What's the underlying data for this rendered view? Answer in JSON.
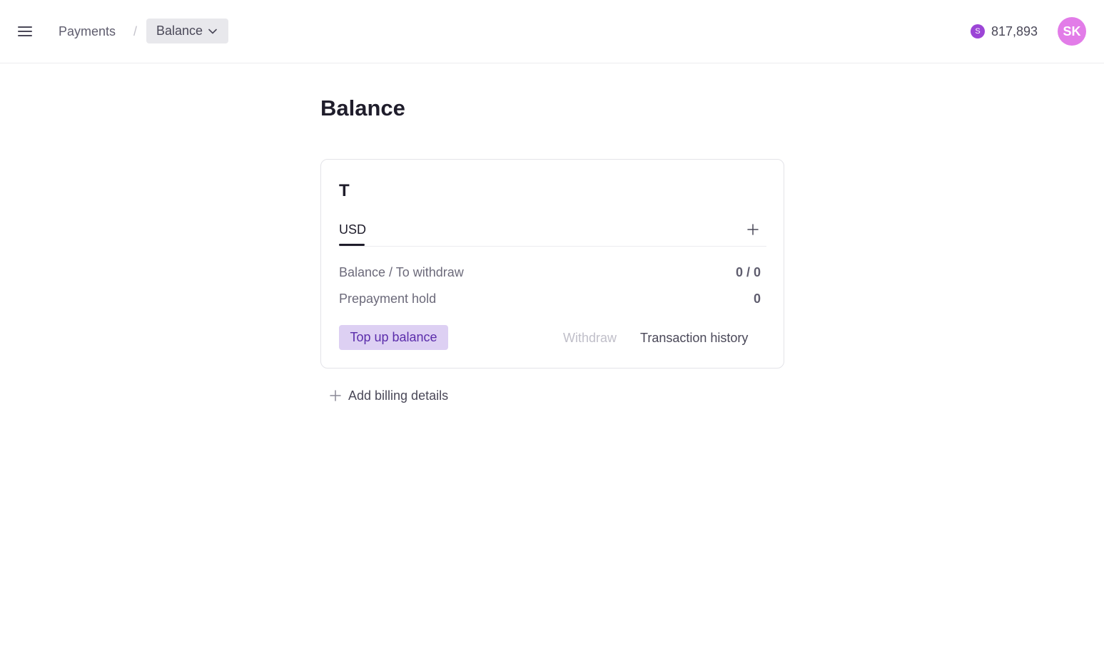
{
  "header": {
    "breadcrumb": {
      "parent": "Payments",
      "separator": "/",
      "current": "Balance"
    },
    "credits": {
      "coin_symbol": "S",
      "value": "817,893"
    },
    "avatar_initials": "SK"
  },
  "page": {
    "title": "Balance"
  },
  "balance_card": {
    "title": "T",
    "tabs": [
      {
        "label": "USD",
        "active": true
      }
    ],
    "rows": [
      {
        "label": "Balance / To withdraw",
        "value": "0 / 0"
      },
      {
        "label": "Prepayment hold",
        "value": "0"
      }
    ],
    "actions": {
      "top_up": "Top up balance",
      "withdraw": "Withdraw",
      "history": "Transaction history"
    }
  },
  "add_billing": {
    "label": "Add billing details"
  },
  "colors": {
    "accent": "#5b2dab",
    "accent_bg": "#ddd0f3",
    "coin": "#9c45d6",
    "avatar": "#e27ce8"
  }
}
